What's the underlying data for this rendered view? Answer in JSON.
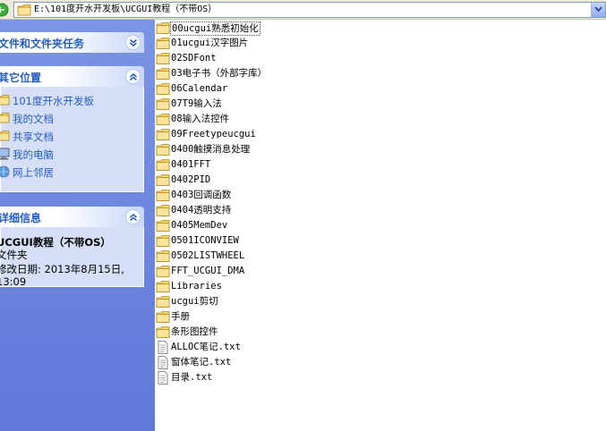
{
  "address": {
    "path": "E:\\101度开水开发板\\UCGUI教程（不带OS）"
  },
  "tasks": {
    "title": "文件和文件夹任务"
  },
  "other_places": {
    "title": "其它位置",
    "items": [
      {
        "label": "101度开水开发板",
        "icon": "folder-icon"
      },
      {
        "label": "我的文档",
        "icon": "folder-icon"
      },
      {
        "label": "共享文档",
        "icon": "folder-icon"
      },
      {
        "label": "我的电脑",
        "icon": "computer-icon"
      },
      {
        "label": "网上邻居",
        "icon": "network-icon"
      }
    ]
  },
  "details": {
    "title": "详细信息",
    "name": "UCGUI教程（不带OS）",
    "type": "文件夹",
    "modified_line1": "修改日期: 2013年8月15日,",
    "modified_line2": "13:09"
  },
  "files": [
    {
      "name": "00ucgui熟悉初始化",
      "type": "folder"
    },
    {
      "name": "01ucgui汉字图片",
      "type": "folder"
    },
    {
      "name": "02SDFont",
      "type": "folder"
    },
    {
      "name": "03电子书（外部字库）",
      "type": "folder"
    },
    {
      "name": "06Calendar",
      "type": "folder"
    },
    {
      "name": "07T9输入法",
      "type": "folder"
    },
    {
      "name": "08输入法控件",
      "type": "folder"
    },
    {
      "name": "09Freetypeucgui",
      "type": "folder"
    },
    {
      "name": "0400触摸消息处理",
      "type": "folder"
    },
    {
      "name": "0401FFT",
      "type": "folder"
    },
    {
      "name": "0402PID",
      "type": "folder"
    },
    {
      "name": "0403回调函数",
      "type": "folder"
    },
    {
      "name": "0404透明支持",
      "type": "folder"
    },
    {
      "name": "0405MemDev",
      "type": "folder"
    },
    {
      "name": "0501ICONVIEW",
      "type": "folder"
    },
    {
      "name": "0502LISTWHEEL",
      "type": "folder"
    },
    {
      "name": "FFT_UCGUI_DMA",
      "type": "folder"
    },
    {
      "name": "Libraries",
      "type": "folder"
    },
    {
      "name": "ucgui剪切",
      "type": "folder"
    },
    {
      "name": "手册",
      "type": "folder"
    },
    {
      "name": "条形图控件",
      "type": "folder"
    },
    {
      "name": "ALLOC笔记.txt",
      "type": "text"
    },
    {
      "name": "窗体笔记.txt",
      "type": "text"
    },
    {
      "name": "目录.txt",
      "type": "text"
    }
  ],
  "colors": {
    "link": "#215dc6",
    "pane": "#6f87de",
    "folder": "#f5d36b"
  }
}
